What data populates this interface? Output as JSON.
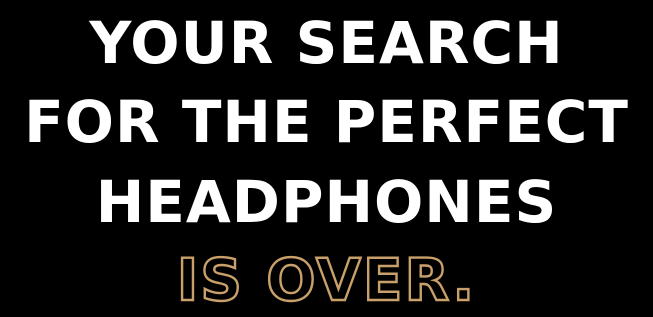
{
  "headline": {
    "line1": "YOUR SEARCH",
    "line2": "FOR THE PERFECT",
    "line3": "HEADPHONES",
    "tagline": "IS OVER."
  },
  "colors": {
    "background": "#000000",
    "headline_text": "#ffffff",
    "tagline_outline": "#c9a06a"
  }
}
